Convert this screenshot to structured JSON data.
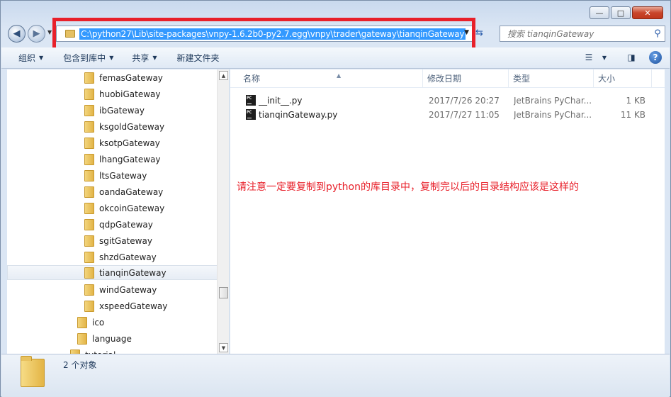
{
  "window": {
    "caption": {
      "minimize": "—",
      "maximize": "□",
      "close": "✕"
    }
  },
  "nav": {
    "address_path": "C:\\python27\\Lib\\site-packages\\vnpy-1.6.2b0-py2.7.egg\\vnpy\\trader\\gateway\\tianqinGateway",
    "search_placeholder": "搜索 tianqinGateway"
  },
  "toolbar": {
    "organize": "组织",
    "include_in_library": "包含到库中",
    "share": "共享",
    "new_folder": "新建文件夹"
  },
  "tree": {
    "items": [
      {
        "label": "femasGateway"
      },
      {
        "label": "huobiGateway"
      },
      {
        "label": "ibGateway"
      },
      {
        "label": "ksgoldGateway"
      },
      {
        "label": "ksotpGateway"
      },
      {
        "label": "lhangGateway"
      },
      {
        "label": "ltsGateway"
      },
      {
        "label": "oandaGateway"
      },
      {
        "label": "okcoinGateway"
      },
      {
        "label": "qdpGateway"
      },
      {
        "label": "sgitGateway"
      },
      {
        "label": "shzdGateway"
      },
      {
        "label": "tianqinGateway"
      },
      {
        "label": "windGateway"
      },
      {
        "label": "xspeedGateway"
      },
      {
        "label": "ico"
      },
      {
        "label": "language"
      },
      {
        "label": "tutorial"
      }
    ]
  },
  "columns": {
    "name": "名称",
    "modified": "修改日期",
    "type": "类型",
    "size": "大小"
  },
  "files": [
    {
      "name": "__init__.py",
      "modified": "2017/7/26 20:27",
      "type": "JetBrains PyChar...",
      "size": "1 KB",
      "icon": "PC"
    },
    {
      "name": "tianqinGateway.py",
      "modified": "2017/7/27 11:05",
      "type": "JetBrains PyChar...",
      "size": "11 KB",
      "icon": "PC"
    }
  ],
  "annotation": "请注意一定要复制到python的库目录中，复制完以后的目录结构应该是这样的",
  "status": {
    "count": "2 个对象"
  },
  "colors": {
    "highlight_red": "#e8202a",
    "selection_blue": "#3399ff"
  }
}
